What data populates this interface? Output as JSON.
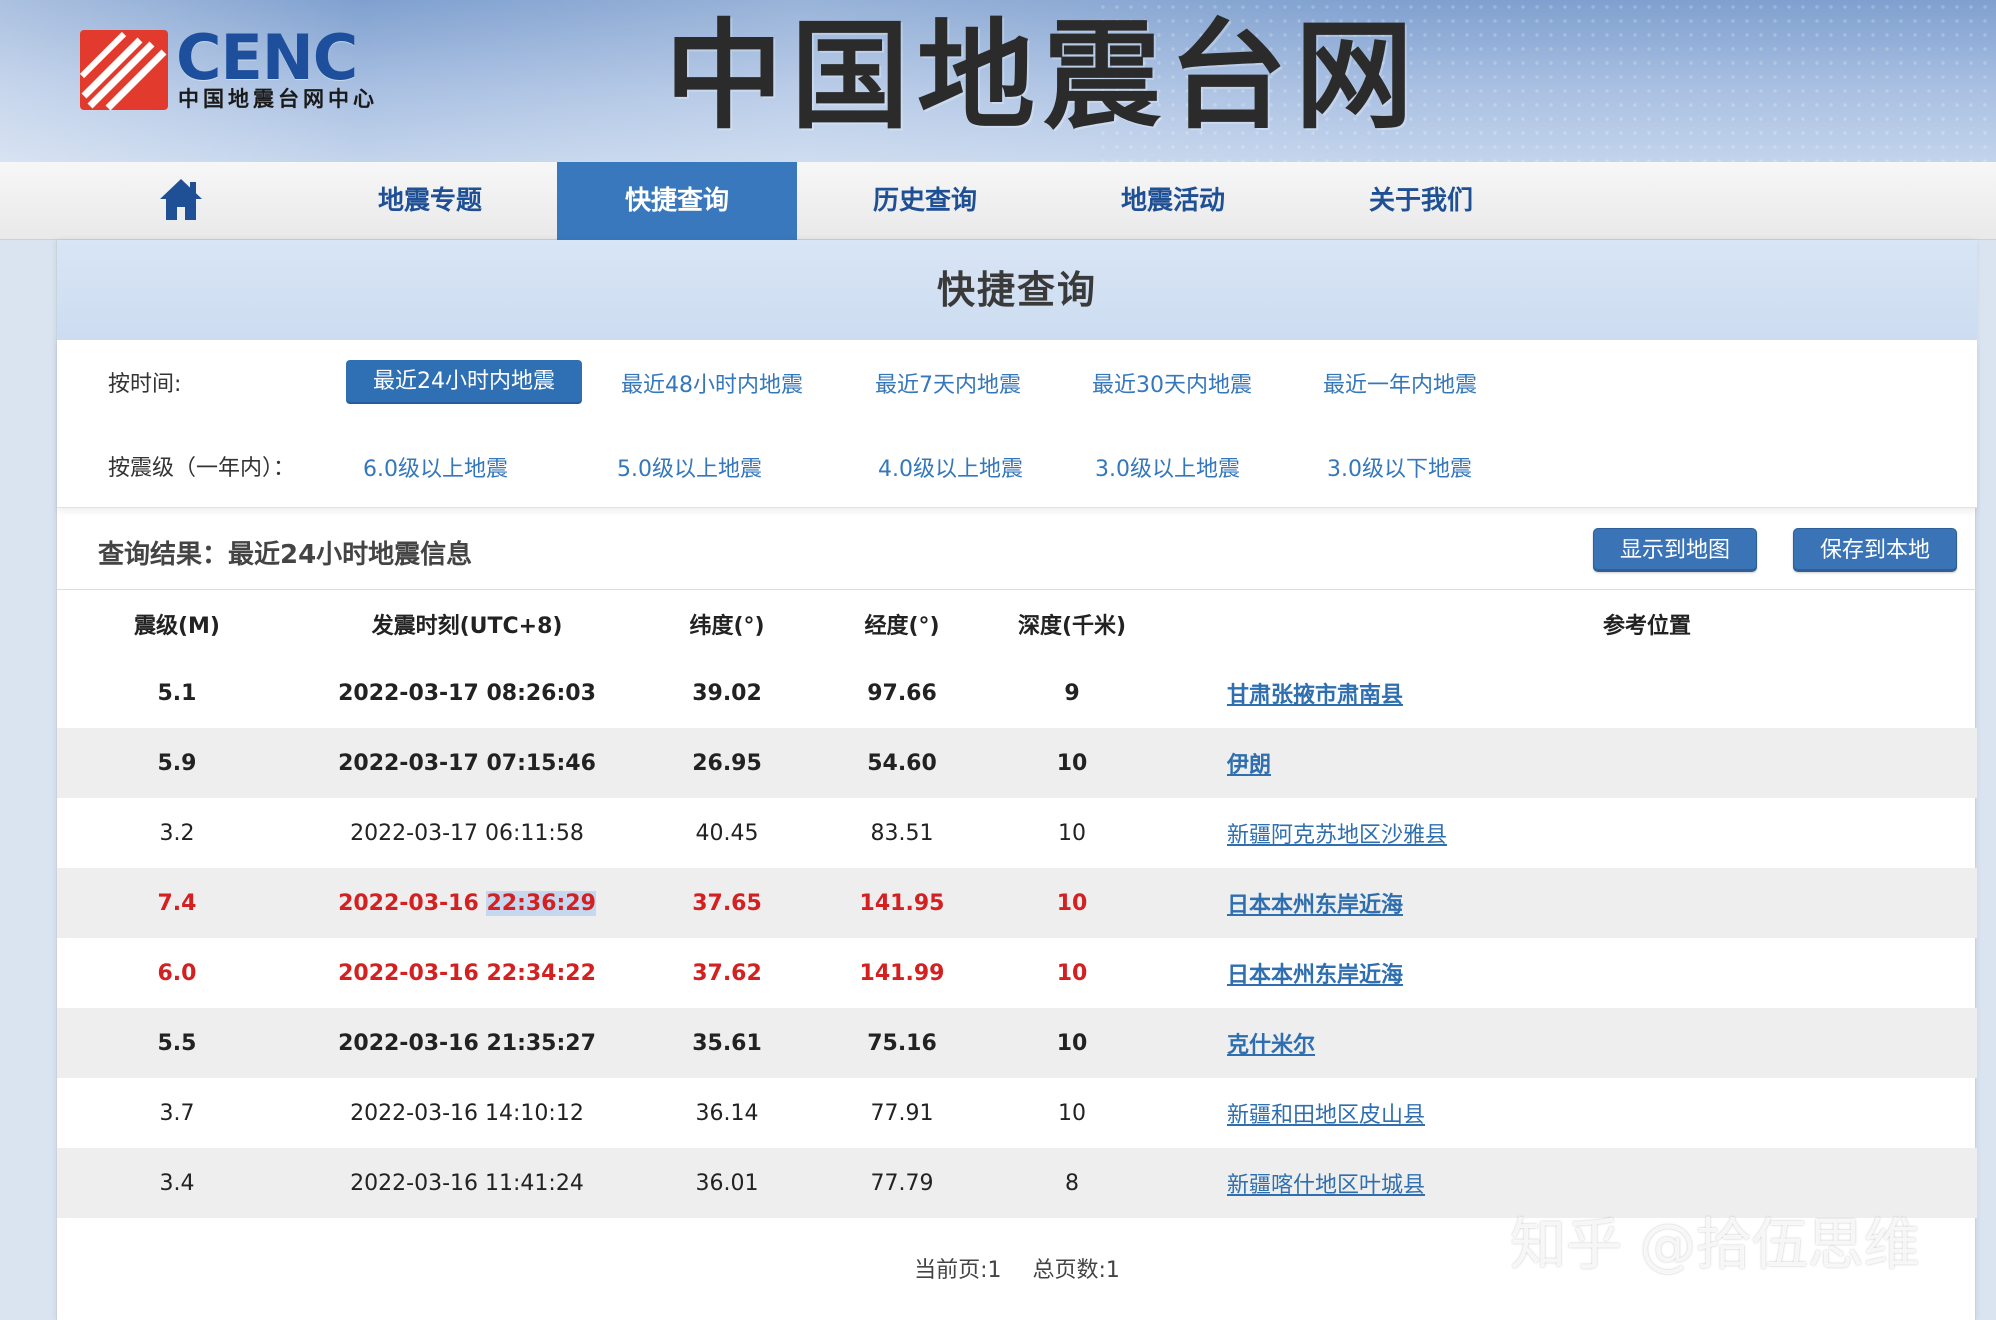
{
  "header": {
    "logo_text": "CENC",
    "logo_subtitle": "中国地震台网中心",
    "site_title": "中国地震台网",
    "brand_colors": {
      "logo_red": "#e23b2e",
      "logo_blue": "#1e4f9c"
    }
  },
  "nav": {
    "home_icon": "home-icon",
    "items": [
      {
        "label": "地震专题",
        "active": false
      },
      {
        "label": "快捷查询",
        "active": true
      },
      {
        "label": "历史查询",
        "active": false
      },
      {
        "label": "地震活动",
        "active": false
      },
      {
        "label": "关于我们",
        "active": false
      }
    ],
    "active_color": "#3a78bd"
  },
  "panel": {
    "title": "快捷查询"
  },
  "filters": {
    "time": {
      "label": "按时间:",
      "options": [
        "最近24小时内地震",
        "最近48小时内地震",
        "最近7天内地震",
        "最近30天内地震",
        "最近一年内地震"
      ],
      "selected": "最近24小时内地震"
    },
    "magnitude": {
      "label": "按震级（一年内）：",
      "options": [
        "6.0级以上地震",
        "5.0级以上地震",
        "4.0级以上地震",
        "3.0级以上地震",
        "3.0级以下地震"
      ]
    }
  },
  "results": {
    "title": "查询结果：最近24小时地震信息",
    "show_map_label": "显示到地图",
    "save_local_label": "保存到本地"
  },
  "table": {
    "headers": {
      "mag": "震级(M)",
      "time": "发震时刻(UTC+8)",
      "lat": "纬度(°)",
      "lon": "经度(°)",
      "depth": "深度(千米)",
      "location": "参考位置"
    },
    "rows": [
      {
        "mag": "5.1",
        "time": "2022-03-17 08:26:03",
        "lat": "39.02",
        "lon": "97.66",
        "depth": "9",
        "location": "甘肃张掖市肃南县",
        "style": "bold"
      },
      {
        "mag": "5.9",
        "time": "2022-03-17 07:15:46",
        "lat": "26.95",
        "lon": "54.60",
        "depth": "10",
        "location": "伊朗",
        "style": "bold"
      },
      {
        "mag": "3.2",
        "time": "2022-03-17 06:11:58",
        "lat": "40.45",
        "lon": "83.51",
        "depth": "10",
        "location": "新疆阿克苏地区沙雅县",
        "style": "normal"
      },
      {
        "mag": "7.4",
        "time_date": "2022-03-16",
        "time_clock": "22:36:29",
        "lat": "37.65",
        "lon": "141.95",
        "depth": "10",
        "location": "日本本州东岸近海",
        "style": "red"
      },
      {
        "mag": "6.0",
        "time": "2022-03-16 22:34:22",
        "lat": "37.62",
        "lon": "141.99",
        "depth": "10",
        "location": "日本本州东岸近海",
        "style": "red"
      },
      {
        "mag": "5.5",
        "time": "2022-03-16 21:35:27",
        "lat": "35.61",
        "lon": "75.16",
        "depth": "10",
        "location": "克什米尔",
        "style": "bold"
      },
      {
        "mag": "3.7",
        "time": "2022-03-16 14:10:12",
        "lat": "36.14",
        "lon": "77.91",
        "depth": "10",
        "location": "新疆和田地区皮山县",
        "style": "normal"
      },
      {
        "mag": "3.4",
        "time": "2022-03-16 11:41:24",
        "lat": "36.01",
        "lon": "77.79",
        "depth": "8",
        "location": "新疆喀什地区叶城县",
        "style": "normal"
      }
    ],
    "highlight_color": "#d42020"
  },
  "pager": {
    "current": "当前页:1",
    "total": "总页数:1"
  },
  "watermark": "知乎 @拾伍思维"
}
